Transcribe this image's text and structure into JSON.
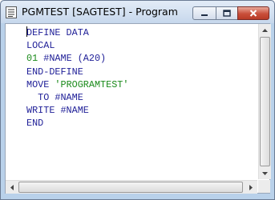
{
  "window": {
    "title": "PGMTEST [SAGTEST] - Program",
    "icon": "program-document-icon"
  },
  "editor": {
    "lines": [
      {
        "parts": [
          {
            "text": "DEFINE DATA",
            "style": "kw"
          }
        ]
      },
      {
        "parts": [
          {
            "text": "LOCAL",
            "style": "kw"
          }
        ]
      },
      {
        "parts": [
          {
            "text": "01",
            "style": "num"
          },
          {
            "text": " #NAME (A20)",
            "style": "kw"
          }
        ]
      },
      {
        "parts": [
          {
            "text": "END-DEFINE",
            "style": "kw"
          }
        ]
      },
      {
        "parts": [
          {
            "text": "MOVE ",
            "style": "kw"
          },
          {
            "text": "'PROGRAMTEST'",
            "style": "str"
          }
        ]
      },
      {
        "parts": [
          {
            "text": "  TO #NAME",
            "style": "kw"
          }
        ]
      },
      {
        "parts": [
          {
            "text": "WRITE #NAME",
            "style": "kw"
          }
        ]
      },
      {
        "parts": [
          {
            "text": "END",
            "style": "kw"
          }
        ]
      }
    ]
  },
  "colors": {
    "keyword": "#202098",
    "literal": "#1a8a1a",
    "close_button": "#c94f3a"
  }
}
